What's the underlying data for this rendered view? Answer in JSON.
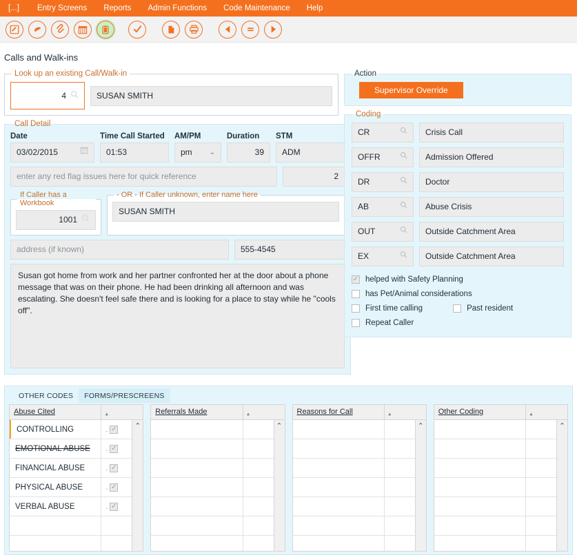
{
  "menubar": {
    "items": [
      {
        "label": "[...]"
      },
      {
        "label": "Entry Screens"
      },
      {
        "label": "Reports"
      },
      {
        "label": "Admin Functions"
      },
      {
        "label": "Code Maintenance"
      },
      {
        "label": "Help"
      }
    ]
  },
  "toolbar": {
    "buttons": [
      {
        "icon": "edit-form-icon",
        "active": false
      },
      {
        "icon": "pin-icon",
        "active": false
      },
      {
        "icon": "paperclip-icon",
        "active": false
      },
      {
        "icon": "calendar-icon",
        "active": false
      },
      {
        "icon": "clipboard-icon",
        "active": true
      },
      {
        "icon": "checkmark-icon",
        "active": false
      },
      {
        "icon": "document-icon",
        "active": false
      },
      {
        "icon": "printer-icon",
        "active": false
      },
      {
        "icon": "previous-icon",
        "active": false
      },
      {
        "icon": "list-icon",
        "active": false
      },
      {
        "icon": "next-icon",
        "active": false
      }
    ]
  },
  "page": {
    "title": "Calls and Walk-ins"
  },
  "lookup": {
    "legend": "Look up an existing Call/Walk-in",
    "id_value": "4",
    "name_value": "SUSAN SMITH"
  },
  "call_detail": {
    "legend": "Call Detail",
    "fields": {
      "date_label": "Date",
      "date_value": "03/02/2015",
      "time_label": "Time Call Started",
      "time_value": "01:53",
      "ampm_label": "AM/PM",
      "ampm_value": "pm",
      "ampm_options": [
        "am",
        "pm"
      ],
      "duration_label": "Duration",
      "duration_value": "39",
      "stm_label": "STM",
      "stm_value": "ADM"
    },
    "redflag_placeholder": "enter any red flag issues here for quick reference",
    "redflag_count": "2",
    "workbook_legend": "If Caller has a Workbook",
    "workbook_value": "1001",
    "unknown_legend": "- OR - If Caller unknown, enter name here",
    "unknown_value": "SUSAN SMITH",
    "address_placeholder": "address (if known)",
    "phone_value": "555-4545",
    "notes": "Susan got home from work and her partner confronted her at the door about a phone message that was on their phone.  He had been drinking all afternoon and was escalating.  She doesn't feel safe there and is looking for a place to stay while he \"cools off\"."
  },
  "action": {
    "legend": "Action",
    "supervisor_override_label": "Supervisor Override",
    "accent_color": "#f4701f"
  },
  "coding": {
    "legend": "Coding",
    "rows": [
      {
        "code": "CR",
        "description": "Crisis Call"
      },
      {
        "code": "OFFR",
        "description": "Admission Offered"
      },
      {
        "code": "DR",
        "description": "Doctor"
      },
      {
        "code": "AB",
        "description": "Abuse Crisis"
      },
      {
        "code": "OUT",
        "description": "Outside Catchment Area"
      },
      {
        "code": "EX",
        "description": "Outside Catchment Area"
      }
    ],
    "checkboxes": [
      {
        "label": "helped with Safety Planning",
        "checked": true
      },
      {
        "label": "has Pet/Animal considerations",
        "checked": false
      },
      {
        "label": "First time calling",
        "checked": false
      },
      {
        "label": "Past resident",
        "checked": false
      },
      {
        "label": "Repeat Caller",
        "checked": false
      }
    ]
  },
  "bottom": {
    "tabs": [
      {
        "label": "OTHER CODES",
        "selected": false
      },
      {
        "label": "FORMS/PRESCREENS",
        "selected": true
      }
    ],
    "grids": [
      {
        "header_1": "Abuse Cited",
        "header_2": ".",
        "rows": [
          {
            "text": "CONTROLLING",
            "checked": true,
            "marked": true,
            "strike": false
          },
          {
            "text": "EMOTIONAL ABUSE",
            "checked": true,
            "marked": false,
            "strike": true
          },
          {
            "text": "FINANCIAL ABUSE",
            "checked": true,
            "marked": false,
            "strike": false
          },
          {
            "text": "PHYSICAL ABUSE",
            "checked": true,
            "marked": false,
            "strike": false
          },
          {
            "text": "VERBAL ABUSE",
            "checked": true,
            "marked": false,
            "strike": false
          },
          {
            "text": "",
            "checked": false,
            "marked": false,
            "strike": false
          },
          {
            "text": "",
            "checked": false,
            "marked": false,
            "strike": false
          }
        ]
      },
      {
        "header_1": "Referrals Made",
        "header_2": ".",
        "rows": [
          {
            "text": "",
            "checked": false,
            "marked": false,
            "strike": false
          },
          {
            "text": "",
            "checked": false,
            "marked": false,
            "strike": false
          },
          {
            "text": "",
            "checked": false,
            "marked": false,
            "strike": false
          },
          {
            "text": "",
            "checked": false,
            "marked": false,
            "strike": false
          },
          {
            "text": "",
            "checked": false,
            "marked": false,
            "strike": false
          },
          {
            "text": "",
            "checked": false,
            "marked": false,
            "strike": false
          },
          {
            "text": "",
            "checked": false,
            "marked": false,
            "strike": false
          }
        ]
      },
      {
        "header_1": "Reasons for Call",
        "header_2": ".",
        "rows": [
          {
            "text": "",
            "checked": false,
            "marked": false,
            "strike": false
          },
          {
            "text": "",
            "checked": false,
            "marked": false,
            "strike": false
          },
          {
            "text": "",
            "checked": false,
            "marked": false,
            "strike": false
          },
          {
            "text": "",
            "checked": false,
            "marked": false,
            "strike": false
          },
          {
            "text": "",
            "checked": false,
            "marked": false,
            "strike": false
          },
          {
            "text": "",
            "checked": false,
            "marked": false,
            "strike": false
          },
          {
            "text": "",
            "checked": false,
            "marked": false,
            "strike": false
          }
        ]
      },
      {
        "header_1": "Other Coding",
        "header_2": ".",
        "rows": [
          {
            "text": "",
            "checked": false,
            "marked": false,
            "strike": false
          },
          {
            "text": "",
            "checked": false,
            "marked": false,
            "strike": false
          },
          {
            "text": "",
            "checked": false,
            "marked": false,
            "strike": false
          },
          {
            "text": "",
            "checked": false,
            "marked": false,
            "strike": false
          },
          {
            "text": "",
            "checked": false,
            "marked": false,
            "strike": false
          },
          {
            "text": "",
            "checked": false,
            "marked": false,
            "strike": false
          },
          {
            "text": "",
            "checked": false,
            "marked": false,
            "strike": false
          }
        ]
      }
    ]
  }
}
